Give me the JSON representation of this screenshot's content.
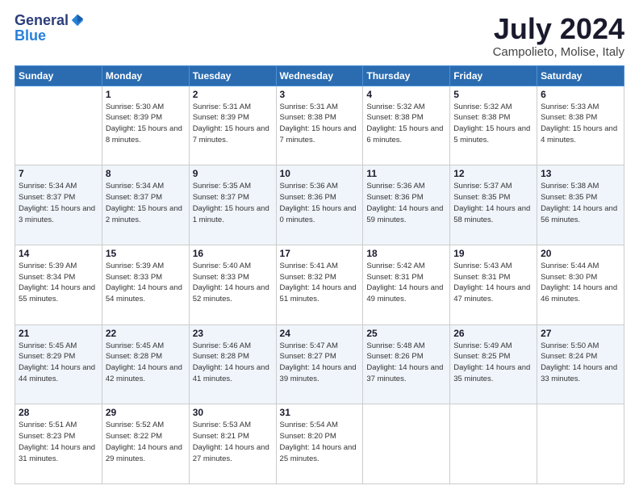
{
  "header": {
    "logo_general": "General",
    "logo_blue": "Blue",
    "month": "July 2024",
    "location": "Campolieto, Molise, Italy"
  },
  "weekdays": [
    "Sunday",
    "Monday",
    "Tuesday",
    "Wednesday",
    "Thursday",
    "Friday",
    "Saturday"
  ],
  "weeks": [
    [
      {
        "day": "",
        "sunrise": "",
        "sunset": "",
        "daylight": ""
      },
      {
        "day": "1",
        "sunrise": "Sunrise: 5:30 AM",
        "sunset": "Sunset: 8:39 PM",
        "daylight": "Daylight: 15 hours and 8 minutes."
      },
      {
        "day": "2",
        "sunrise": "Sunrise: 5:31 AM",
        "sunset": "Sunset: 8:39 PM",
        "daylight": "Daylight: 15 hours and 7 minutes."
      },
      {
        "day": "3",
        "sunrise": "Sunrise: 5:31 AM",
        "sunset": "Sunset: 8:38 PM",
        "daylight": "Daylight: 15 hours and 7 minutes."
      },
      {
        "day": "4",
        "sunrise": "Sunrise: 5:32 AM",
        "sunset": "Sunset: 8:38 PM",
        "daylight": "Daylight: 15 hours and 6 minutes."
      },
      {
        "day": "5",
        "sunrise": "Sunrise: 5:32 AM",
        "sunset": "Sunset: 8:38 PM",
        "daylight": "Daylight: 15 hours and 5 minutes."
      },
      {
        "day": "6",
        "sunrise": "Sunrise: 5:33 AM",
        "sunset": "Sunset: 8:38 PM",
        "daylight": "Daylight: 15 hours and 4 minutes."
      }
    ],
    [
      {
        "day": "7",
        "sunrise": "Sunrise: 5:34 AM",
        "sunset": "Sunset: 8:37 PM",
        "daylight": "Daylight: 15 hours and 3 minutes."
      },
      {
        "day": "8",
        "sunrise": "Sunrise: 5:34 AM",
        "sunset": "Sunset: 8:37 PM",
        "daylight": "Daylight: 15 hours and 2 minutes."
      },
      {
        "day": "9",
        "sunrise": "Sunrise: 5:35 AM",
        "sunset": "Sunset: 8:37 PM",
        "daylight": "Daylight: 15 hours and 1 minute."
      },
      {
        "day": "10",
        "sunrise": "Sunrise: 5:36 AM",
        "sunset": "Sunset: 8:36 PM",
        "daylight": "Daylight: 15 hours and 0 minutes."
      },
      {
        "day": "11",
        "sunrise": "Sunrise: 5:36 AM",
        "sunset": "Sunset: 8:36 PM",
        "daylight": "Daylight: 14 hours and 59 minutes."
      },
      {
        "day": "12",
        "sunrise": "Sunrise: 5:37 AM",
        "sunset": "Sunset: 8:35 PM",
        "daylight": "Daylight: 14 hours and 58 minutes."
      },
      {
        "day": "13",
        "sunrise": "Sunrise: 5:38 AM",
        "sunset": "Sunset: 8:35 PM",
        "daylight": "Daylight: 14 hours and 56 minutes."
      }
    ],
    [
      {
        "day": "14",
        "sunrise": "Sunrise: 5:39 AM",
        "sunset": "Sunset: 8:34 PM",
        "daylight": "Daylight: 14 hours and 55 minutes."
      },
      {
        "day": "15",
        "sunrise": "Sunrise: 5:39 AM",
        "sunset": "Sunset: 8:33 PM",
        "daylight": "Daylight: 14 hours and 54 minutes."
      },
      {
        "day": "16",
        "sunrise": "Sunrise: 5:40 AM",
        "sunset": "Sunset: 8:33 PM",
        "daylight": "Daylight: 14 hours and 52 minutes."
      },
      {
        "day": "17",
        "sunrise": "Sunrise: 5:41 AM",
        "sunset": "Sunset: 8:32 PM",
        "daylight": "Daylight: 14 hours and 51 minutes."
      },
      {
        "day": "18",
        "sunrise": "Sunrise: 5:42 AM",
        "sunset": "Sunset: 8:31 PM",
        "daylight": "Daylight: 14 hours and 49 minutes."
      },
      {
        "day": "19",
        "sunrise": "Sunrise: 5:43 AM",
        "sunset": "Sunset: 8:31 PM",
        "daylight": "Daylight: 14 hours and 47 minutes."
      },
      {
        "day": "20",
        "sunrise": "Sunrise: 5:44 AM",
        "sunset": "Sunset: 8:30 PM",
        "daylight": "Daylight: 14 hours and 46 minutes."
      }
    ],
    [
      {
        "day": "21",
        "sunrise": "Sunrise: 5:45 AM",
        "sunset": "Sunset: 8:29 PM",
        "daylight": "Daylight: 14 hours and 44 minutes."
      },
      {
        "day": "22",
        "sunrise": "Sunrise: 5:45 AM",
        "sunset": "Sunset: 8:28 PM",
        "daylight": "Daylight: 14 hours and 42 minutes."
      },
      {
        "day": "23",
        "sunrise": "Sunrise: 5:46 AM",
        "sunset": "Sunset: 8:28 PM",
        "daylight": "Daylight: 14 hours and 41 minutes."
      },
      {
        "day": "24",
        "sunrise": "Sunrise: 5:47 AM",
        "sunset": "Sunset: 8:27 PM",
        "daylight": "Daylight: 14 hours and 39 minutes."
      },
      {
        "day": "25",
        "sunrise": "Sunrise: 5:48 AM",
        "sunset": "Sunset: 8:26 PM",
        "daylight": "Daylight: 14 hours and 37 minutes."
      },
      {
        "day": "26",
        "sunrise": "Sunrise: 5:49 AM",
        "sunset": "Sunset: 8:25 PM",
        "daylight": "Daylight: 14 hours and 35 minutes."
      },
      {
        "day": "27",
        "sunrise": "Sunrise: 5:50 AM",
        "sunset": "Sunset: 8:24 PM",
        "daylight": "Daylight: 14 hours and 33 minutes."
      }
    ],
    [
      {
        "day": "28",
        "sunrise": "Sunrise: 5:51 AM",
        "sunset": "Sunset: 8:23 PM",
        "daylight": "Daylight: 14 hours and 31 minutes."
      },
      {
        "day": "29",
        "sunrise": "Sunrise: 5:52 AM",
        "sunset": "Sunset: 8:22 PM",
        "daylight": "Daylight: 14 hours and 29 minutes."
      },
      {
        "day": "30",
        "sunrise": "Sunrise: 5:53 AM",
        "sunset": "Sunset: 8:21 PM",
        "daylight": "Daylight: 14 hours and 27 minutes."
      },
      {
        "day": "31",
        "sunrise": "Sunrise: 5:54 AM",
        "sunset": "Sunset: 8:20 PM",
        "daylight": "Daylight: 14 hours and 25 minutes."
      },
      {
        "day": "",
        "sunrise": "",
        "sunset": "",
        "daylight": ""
      },
      {
        "day": "",
        "sunrise": "",
        "sunset": "",
        "daylight": ""
      },
      {
        "day": "",
        "sunrise": "",
        "sunset": "",
        "daylight": ""
      }
    ]
  ]
}
